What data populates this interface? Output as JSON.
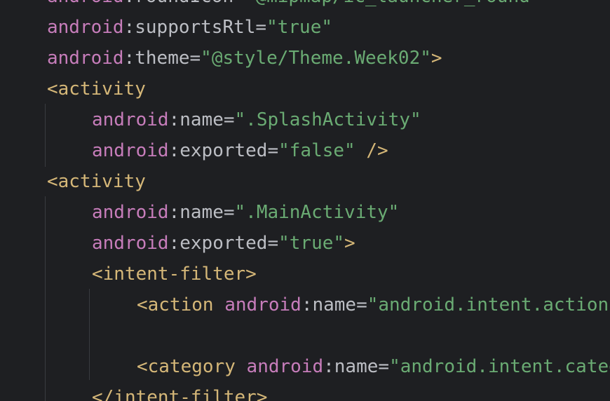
{
  "editor": {
    "lines": [
      {
        "ns": "android",
        "sep": ":",
        "attr": "roundIcon",
        "eq": "=",
        "value": "\"@mipmap/ic_launcher_round\""
      },
      {
        "ns": "android",
        "sep": ":",
        "attr": "supportsRtl",
        "eq": "=",
        "value": "\"true\""
      },
      {
        "ns": "android",
        "sep": ":",
        "attr": "theme",
        "eq": "=",
        "value": "\"@style/Theme.Week02\"",
        "close": ">"
      },
      {
        "tag": "<activity"
      },
      {
        "ns": "android",
        "sep": ":",
        "attr": "name",
        "eq": "=",
        "value": "\".SplashActivity\""
      },
      {
        "ns": "android",
        "sep": ":",
        "attr": "exported",
        "eq": "=",
        "value": "\"false\"",
        "close": " />"
      },
      {
        "tag": "<activity"
      },
      {
        "ns": "android",
        "sep": ":",
        "attr": "name",
        "eq": "=",
        "value": "\".MainActivity\""
      },
      {
        "ns": "android",
        "sep": ":",
        "attr": "exported",
        "eq": "=",
        "value": "\"true\"",
        "close": ">"
      },
      {
        "tag": "<intent-filter>"
      },
      {
        "tag": "<action ",
        "ns": "android",
        "sep": ":",
        "attr": "name",
        "eq": "=",
        "value": "\"android.intent.action.MAIN\" />"
      },
      {
        "tag": "<category ",
        "ns": "android",
        "sep": ":",
        "attr": "name",
        "eq": "=",
        "value": "\"android.intent.category.LAUNCHER\" />"
      },
      {
        "tag": "</intent-filter>"
      }
    ]
  },
  "colors": {
    "background": "#1e1f22",
    "namespace": "#c77dbb",
    "attribute": "#bcbec4",
    "string": "#6aab73",
    "tag": "#d5b778"
  }
}
